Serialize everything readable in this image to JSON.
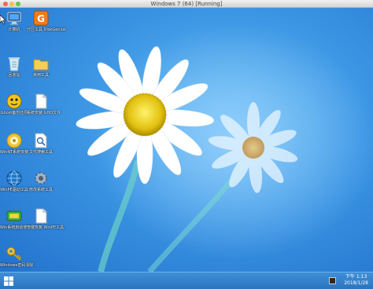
{
  "window": {
    "title": "Windows 7 (64) [Running]"
  },
  "desktop": {
    "icons": [
      {
        "label": "计算机",
        "icon": "computer-icon"
      },
      {
        "label": "分区工具 DiskGenius",
        "icon": "diskgenius-icon"
      },
      {
        "label": "回收站",
        "icon": "recycle-bin-icon"
      },
      {
        "label": "常用工具",
        "icon": "folder-icon"
      },
      {
        "label": "Ghost备份还原",
        "icon": "ghost-icon"
      },
      {
        "label": "系统安装 GHO文件",
        "icon": "document-icon"
      },
      {
        "label": "WinNT系统安装",
        "icon": "disc-icon"
      },
      {
        "label": "文件搜索工具",
        "icon": "search-document-icon"
      },
      {
        "label": "WinPE驱动工具",
        "icon": "network-globe-icon"
      },
      {
        "label": "修改系统工具",
        "icon": "gear-icon"
      },
      {
        "label": "Win系统启动修复",
        "icon": "boot-repair-icon"
      },
      {
        "label": "一键恢复 WinPE工具",
        "icon": "blank-document-icon"
      },
      {
        "label": "Windows密码清除",
        "icon": "key-icon"
      }
    ]
  },
  "taskbar": {
    "start_icon": "windows-logo-icon",
    "tray_icon": "tray-app-icon",
    "clock_time": "下午 1:13",
    "clock_date": "2018/1/28"
  }
}
